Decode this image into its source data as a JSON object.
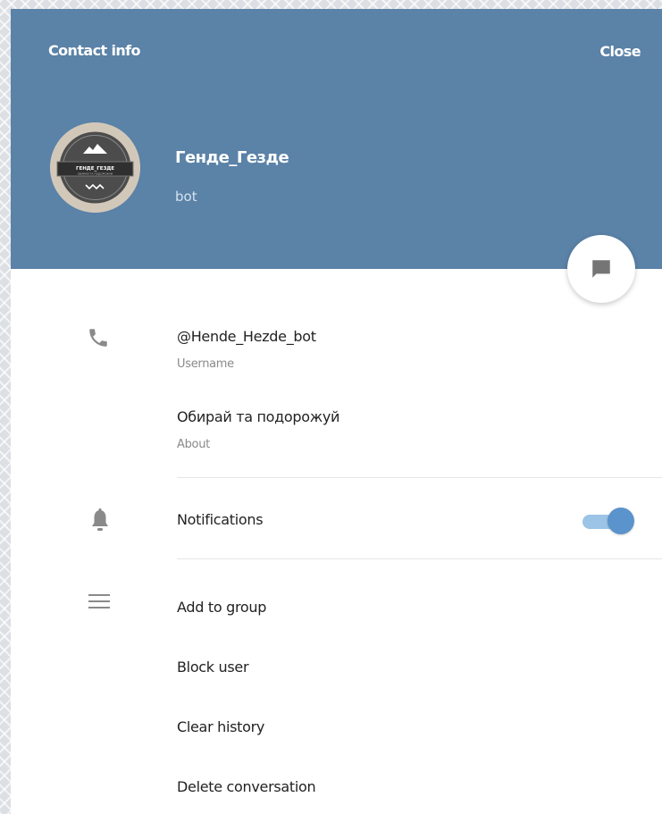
{
  "header": {
    "title": "Contact info",
    "close_label": "Close"
  },
  "profile": {
    "avatar_line1": "ГЕНДЕ_ГЕЗДЕ",
    "avatar_line2": "ОБИРАЙ ТА ПОДОРОЖУЙ",
    "name": "Генде_Гезде",
    "status": "bot"
  },
  "info": {
    "username_value": "@Hende_Hezde_bot",
    "username_label": "Username",
    "about_value": "Обирай та подорожуй",
    "about_label": "About"
  },
  "notifications": {
    "label": "Notifications",
    "enabled": true
  },
  "actions": {
    "add_to_group": "Add to group",
    "block_user": "Block user",
    "clear_history": "Clear history",
    "delete_conversation": "Delete conversation"
  },
  "icons": {
    "phone": "phone-icon",
    "bell": "bell-icon",
    "menu": "menu-icon",
    "message": "message-icon"
  },
  "colors": {
    "header_bg": "#5b82a7",
    "toggle_on": "#5b93cc",
    "toggle_track": "#9cc4e6"
  }
}
